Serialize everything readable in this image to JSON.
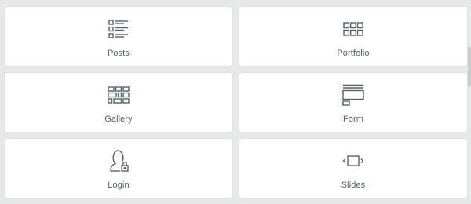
{
  "widgets": [
    {
      "label": "Posts",
      "icon": "posts-list-icon"
    },
    {
      "label": "Portfolio",
      "icon": "portfolio-grid-icon"
    },
    {
      "label": "Gallery",
      "icon": "gallery-grid-icon"
    },
    {
      "label": "Form",
      "icon": "form-icon"
    },
    {
      "label": "Login",
      "icon": "login-user-lock-icon"
    },
    {
      "label": "Slides",
      "icon": "slides-icon"
    }
  ],
  "colors": {
    "background": "#e6e8ea",
    "tile": "#ffffff",
    "icon": "#556068",
    "label": "#556068"
  }
}
